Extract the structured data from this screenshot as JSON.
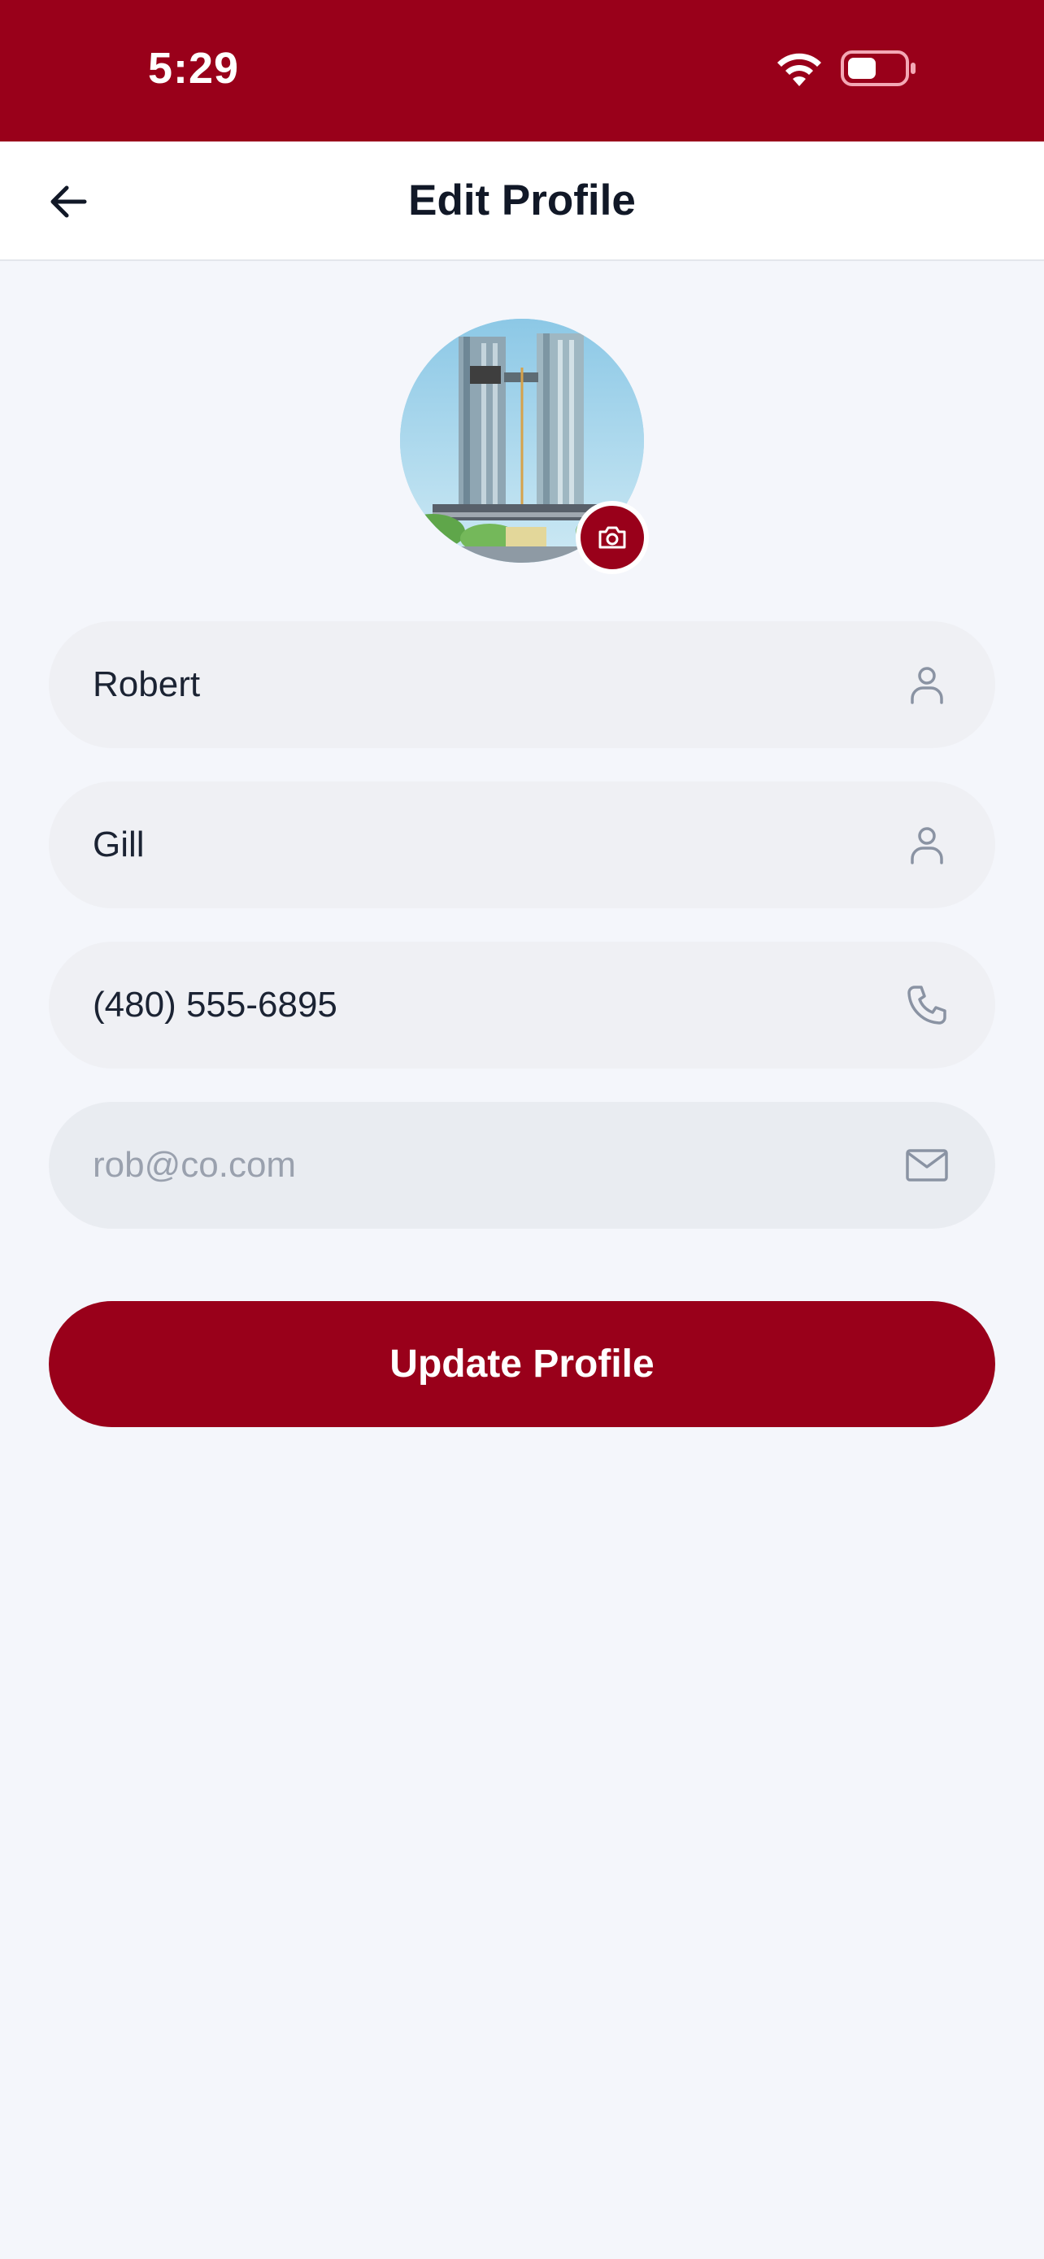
{
  "status_bar": {
    "time": "5:29",
    "wifi_icon": "wifi-icon",
    "battery_icon": "battery-icon",
    "battery_level": 0.5,
    "background_color": "#99001A"
  },
  "header": {
    "title": "Edit Profile",
    "back_icon": "arrow-left-icon"
  },
  "avatar": {
    "camera_icon": "camera-icon"
  },
  "form": {
    "first_name": {
      "value": "Robert",
      "icon": "user-icon"
    },
    "last_name": {
      "value": "Gill",
      "icon": "user-icon"
    },
    "phone": {
      "value": "(480) 555-6895",
      "icon": "phone-icon"
    },
    "email": {
      "value": "",
      "placeholder": "rob@co.com",
      "icon": "mail-icon",
      "disabled": true
    }
  },
  "update_button": {
    "label": "Update Profile"
  },
  "colors": {
    "accent": "#99001A",
    "background": "#F4F6FB",
    "field_background": "#EFF0F4",
    "text": "#111827",
    "icon_gray": "#8A93A3"
  }
}
